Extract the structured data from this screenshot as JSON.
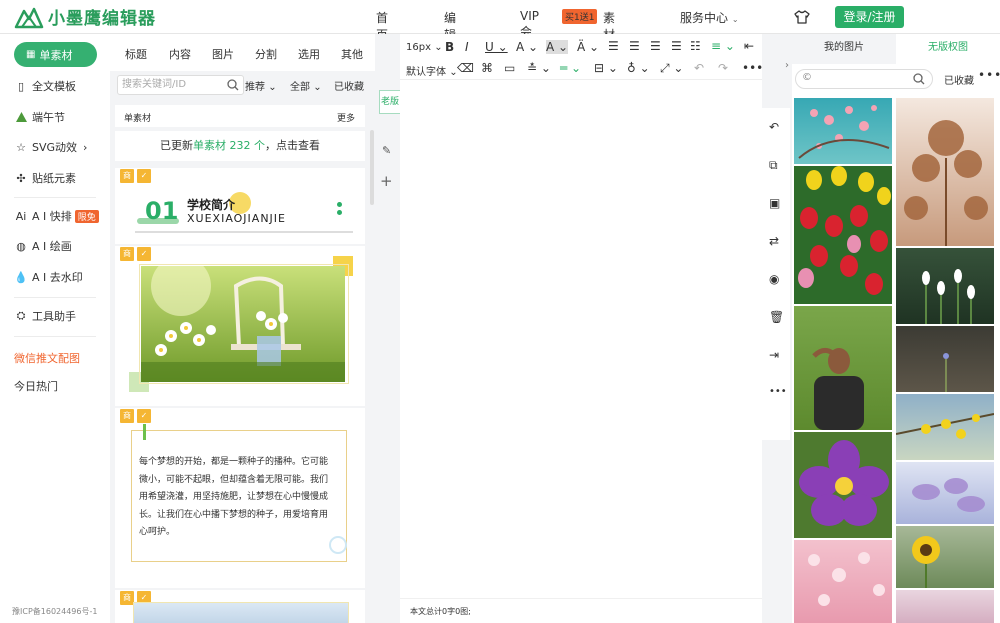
{
  "header": {
    "logo_text": "小墨鹰编辑器",
    "nav": {
      "home": "首页",
      "editor": "编辑器",
      "vip": "VIP会员",
      "vip_badge": "买1送1",
      "assets": "素材库",
      "service": "服务中心"
    },
    "login": "登录/注册"
  },
  "sidebar": {
    "active": "单素材",
    "items": [
      "全文模板",
      "端午节",
      "SVG动效",
      "贴纸元素",
      "A I 快排",
      "A I 绘画",
      "A I 去水印",
      "工具助手",
      "微信推文配图",
      "今日热门"
    ],
    "ai_badge": "限免",
    "icp": "豫ICP备16024496号-1",
    "colors": {
      "accent": "#35b071",
      "wechat_item": "#f0652f"
    }
  },
  "materials": {
    "tabs": [
      "标题",
      "内容",
      "图片",
      "分割",
      "选用",
      "其他"
    ],
    "search_placeholder": "搜索关键词/ID",
    "sort": "推荐",
    "filter": "全部",
    "favorites": "已收藏",
    "section_title": "单素材",
    "more": "更多",
    "update_prefix": "已更新",
    "update_link": "单素材 232 个",
    "update_suffix": "，点击查看",
    "tag_shang": "商",
    "card1": {
      "number": "01",
      "title": "学校简介",
      "subtitle": "XUEXIAOJIANJIE"
    },
    "poem": "每个梦想的开始，都是一颗种子的播种。它可能微小，可能不起眼，但却蕴含着无限可能。我们用希望浇灌，用坚持施肥，让梦想在心中慢慢成长。让我们在心中播下梦想的种子，用爱培育用心呵护。"
  },
  "editor": {
    "old_version": "老版",
    "font_size": "16px",
    "font_family": "默认字体",
    "status": "本文总计0字0图;"
  },
  "image_panel": {
    "tab_my_images": "我的图片",
    "tab_free": "无版权图",
    "favorites": "已收藏",
    "more": "•••"
  }
}
